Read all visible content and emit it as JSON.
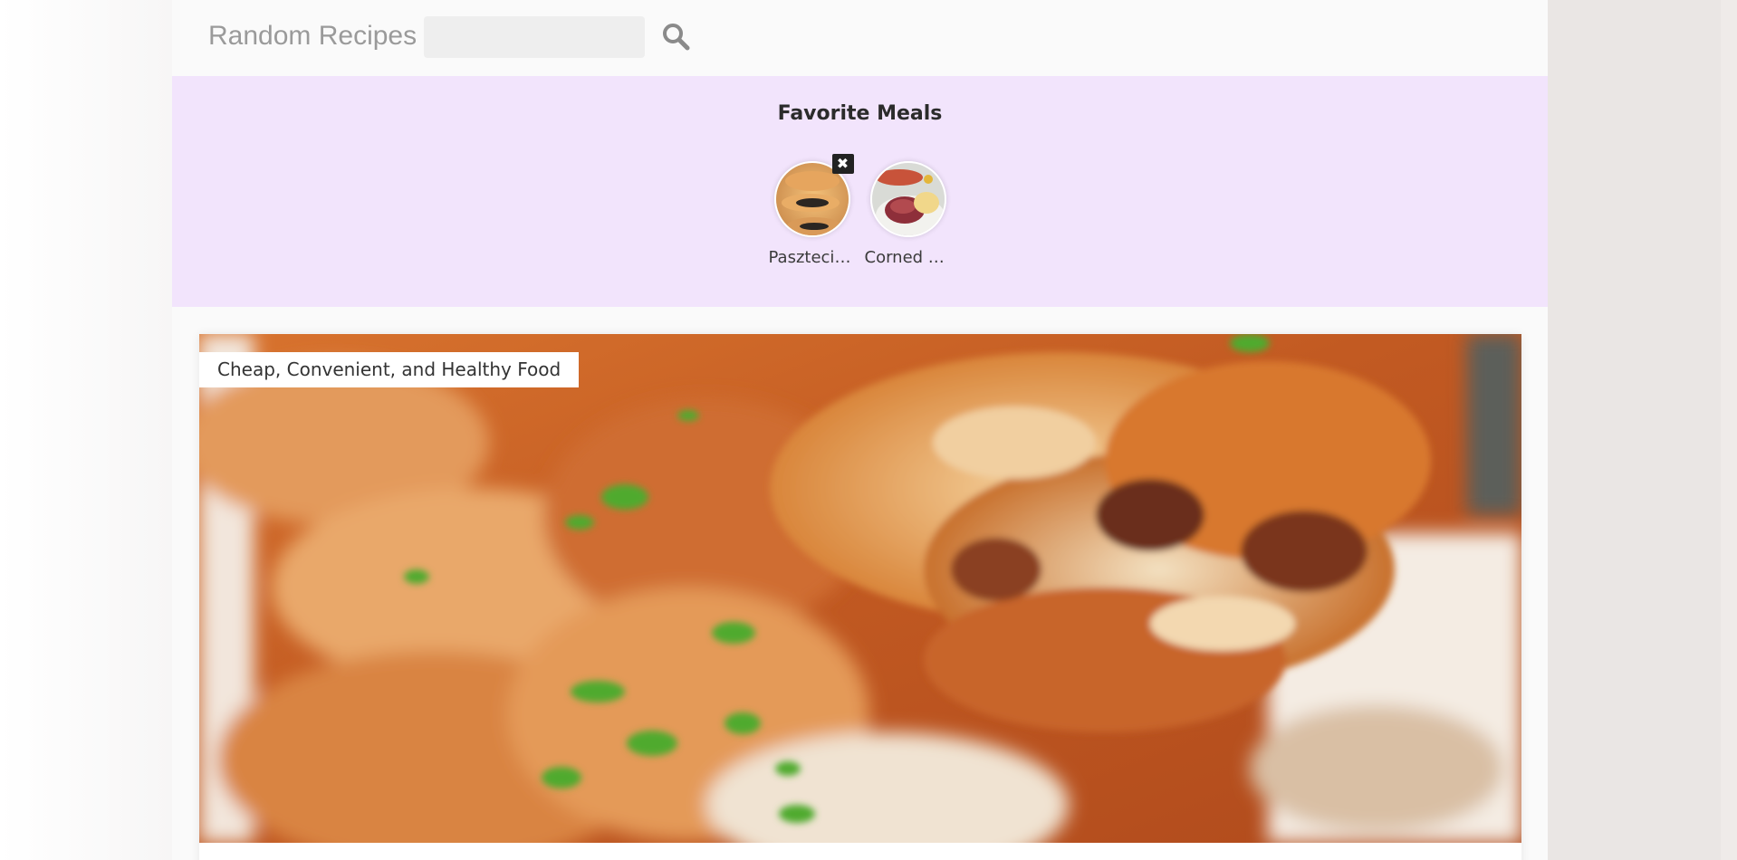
{
  "header": {
    "brand": "Random Recipes",
    "search_placeholder": "",
    "search_value": ""
  },
  "favorites": {
    "title": "Favorite Meals",
    "remove_symbol": "✖",
    "items": [
      {
        "name": "Pasztecik..."
      },
      {
        "name": "Corned B..."
      }
    ]
  },
  "meal": {
    "tag": "Cheap, Convenient, and Healthy Food"
  },
  "icons": {
    "search": "search-icon",
    "remove": "close-icon"
  },
  "colors": {
    "favorites_bg": "#f2e4fc",
    "page_bg": "#fafafa"
  }
}
